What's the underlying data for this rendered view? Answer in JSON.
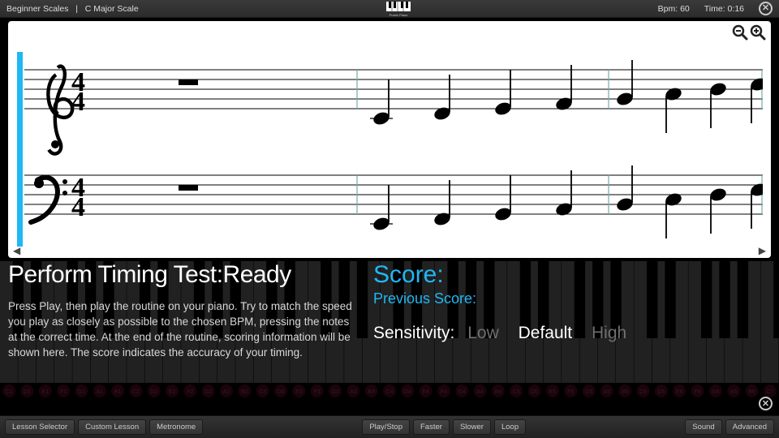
{
  "topbar": {
    "lesson_category": "Beginner Scales",
    "lesson_name": "C Major Scale",
    "bpm_label": "Bpm: 60",
    "time_label": "Time: 0:16",
    "logo_text": "Purely Piano"
  },
  "score_view": {
    "time_signature_top": "4",
    "time_signature_bottom": "4"
  },
  "info": {
    "timing_title": "Perform Timing Test:Ready",
    "instructions": "Press Play, then play the routine on your piano. Try to match the speed you play as closely as possible to the chosen BPM, pressing the notes at the correct time. At the end of the routine, scoring information will be shown here. The score indicates the accuracy of your timing.",
    "score_label": "Score:",
    "previous_score_label": "Previous Score:",
    "sensitivity_label": "Sensitivity:",
    "sensitivity_options": [
      {
        "label": "Low",
        "selected": false
      },
      {
        "label": "Default",
        "selected": true
      },
      {
        "label": "High",
        "selected": false
      }
    ]
  },
  "bottombar": {
    "left": [
      {
        "label": "Lesson Selector"
      },
      {
        "label": "Custom Lesson"
      },
      {
        "label": "Metronome"
      }
    ],
    "center": [
      {
        "label": "Play/Stop"
      },
      {
        "label": "Faster"
      },
      {
        "label": "Slower"
      },
      {
        "label": "Loop"
      }
    ],
    "right": [
      {
        "label": "Sound"
      },
      {
        "label": "Advanced"
      }
    ]
  },
  "piano_key_labels": [
    "C1",
    "D1",
    "E1",
    "F1",
    "G1",
    "A1",
    "B1",
    "C2",
    "D2",
    "E2",
    "F2",
    "G2",
    "A2",
    "B2",
    "C3",
    "D3",
    "E3",
    "F3",
    "G3",
    "A3",
    "B3",
    "C4",
    "D4",
    "E4",
    "F4",
    "G4",
    "A4",
    "B4",
    "C5",
    "D5",
    "E5",
    "F5",
    "G5",
    "A5",
    "B5",
    "C6",
    "D6",
    "E6",
    "F6",
    "G6",
    "A6",
    "B6",
    "C7"
  ]
}
